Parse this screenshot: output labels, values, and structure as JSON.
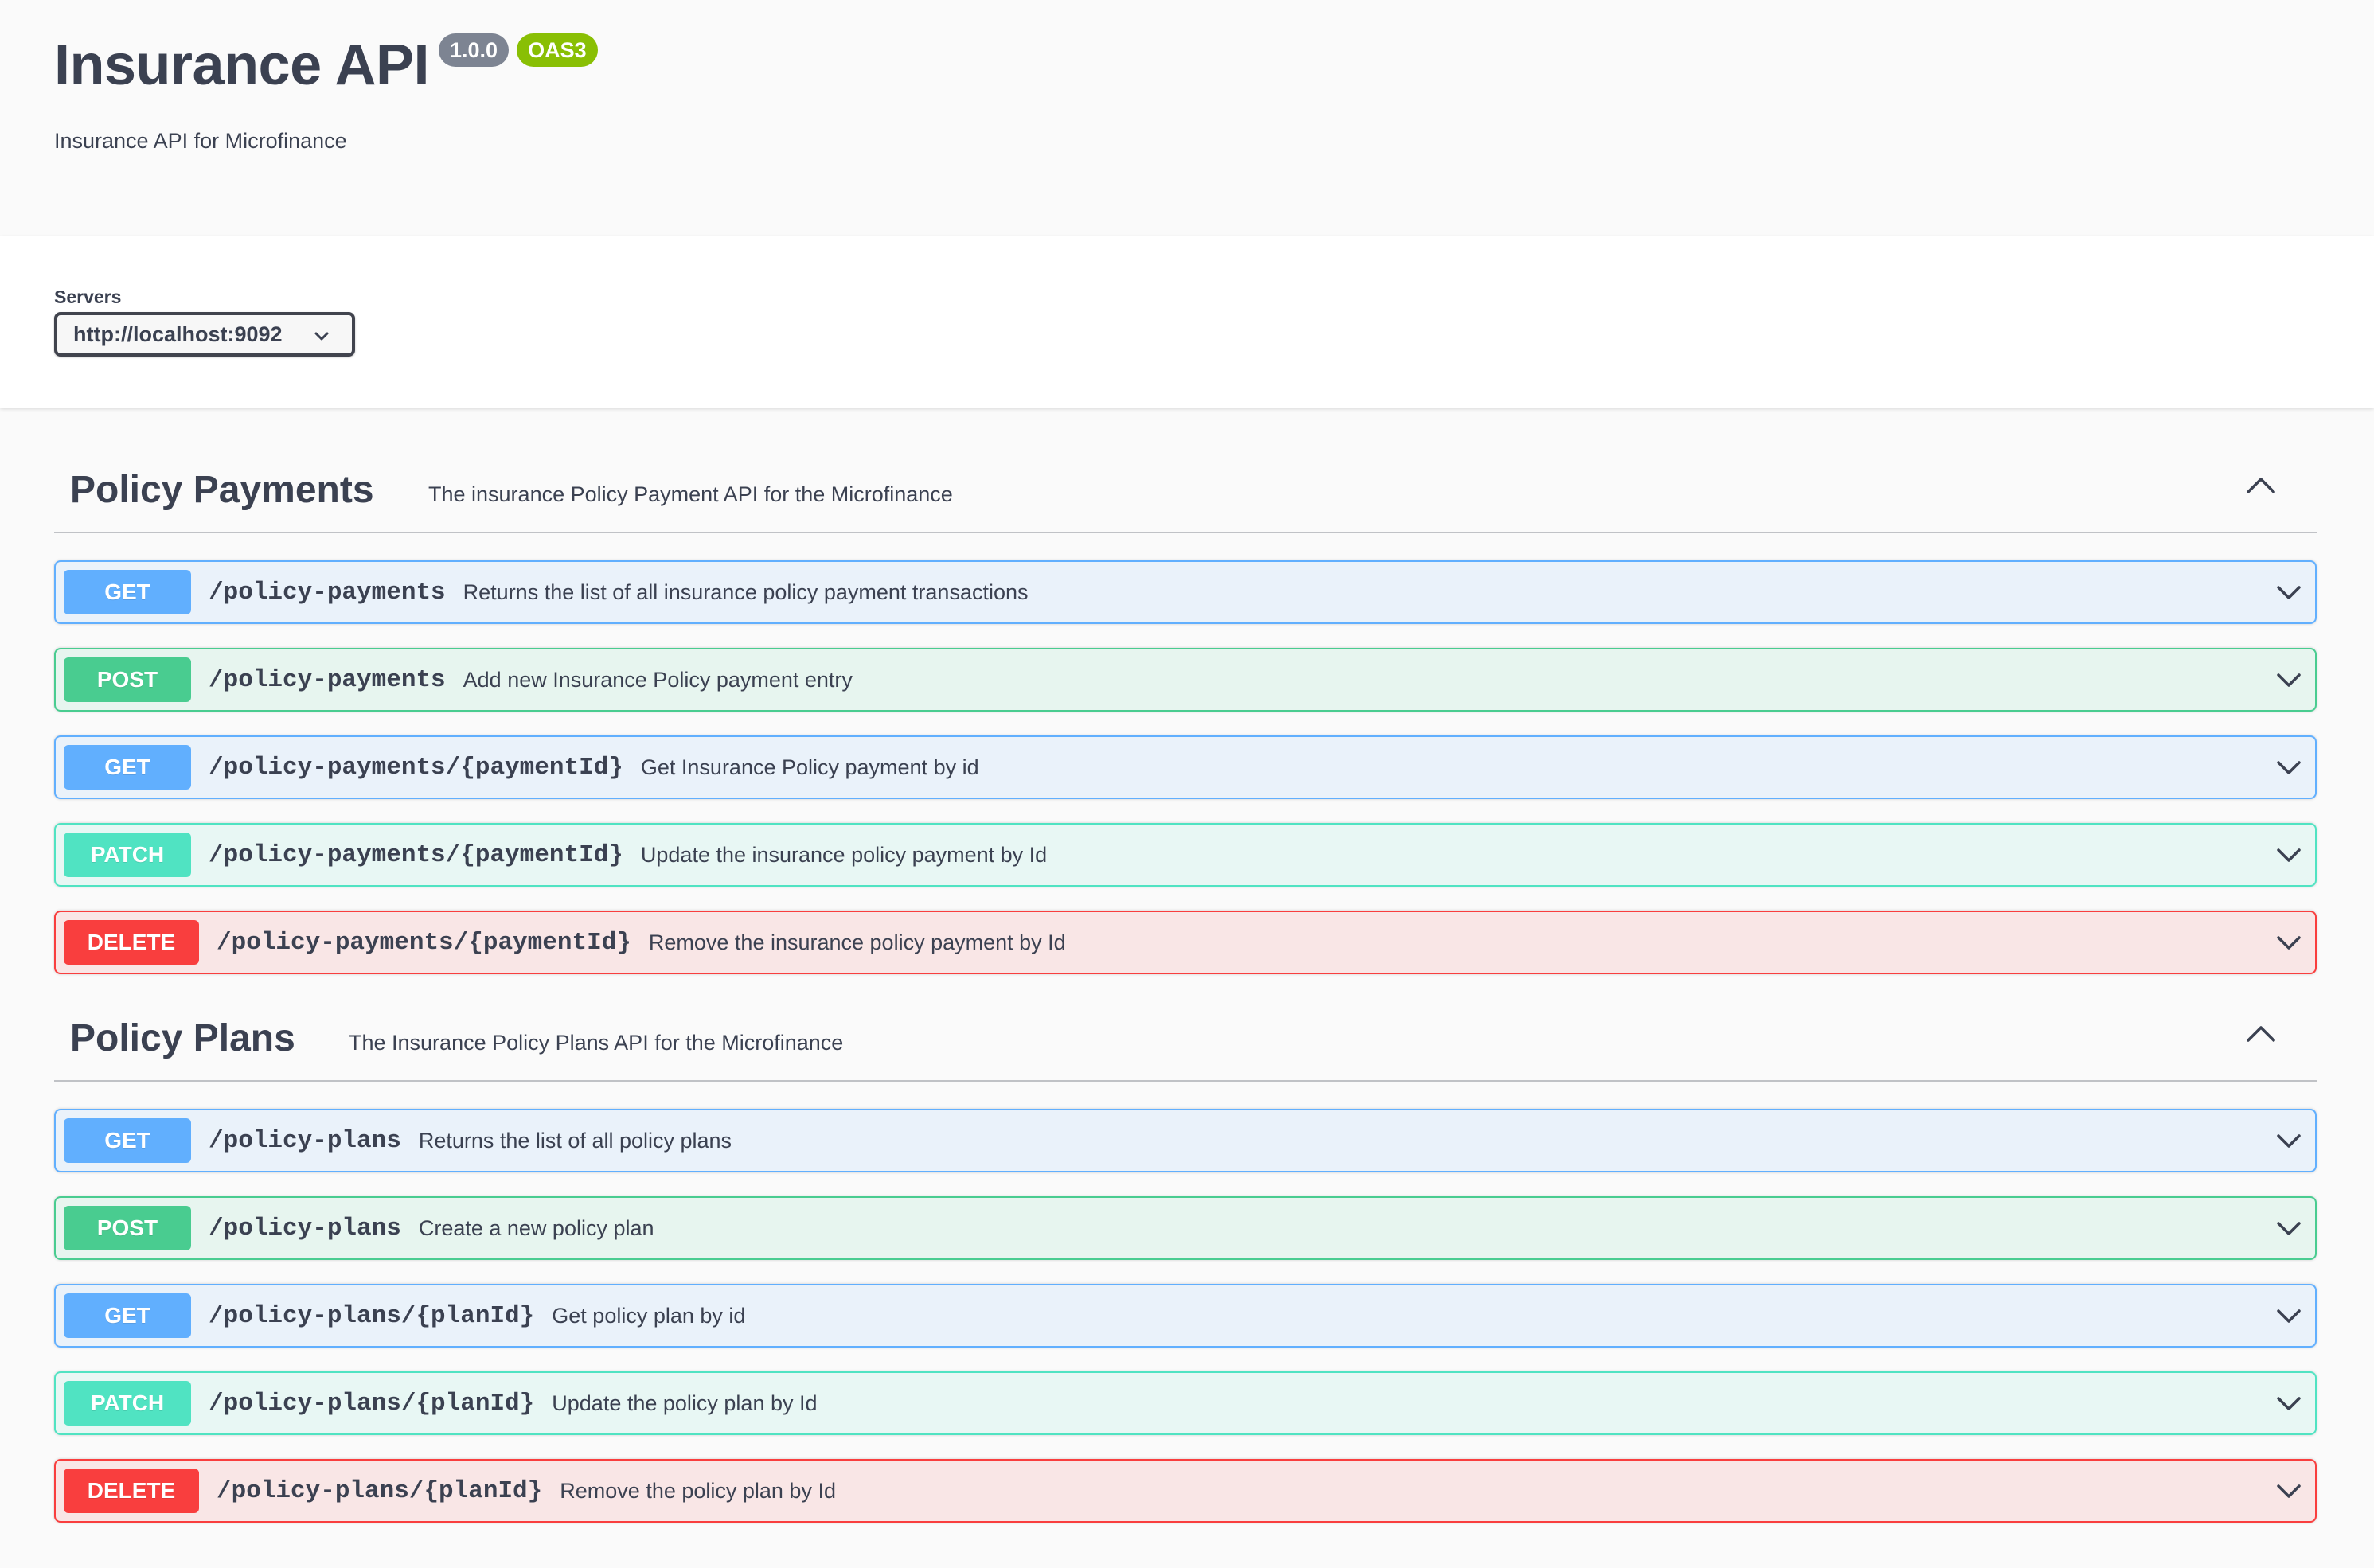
{
  "info": {
    "title": "Insurance API",
    "version": "1.0.0",
    "oas_badge": "OAS3",
    "description": "Insurance API for Microfinance"
  },
  "servers": {
    "label": "Servers",
    "selected": "http://localhost:9092"
  },
  "tags": [
    {
      "name": "Policy Payments",
      "description": "The insurance Policy Payment API for the Microfinance",
      "operations": [
        {
          "method": "GET",
          "path": "/policy-payments",
          "summary": "Returns the list of all insurance policy payment transactions"
        },
        {
          "method": "POST",
          "path": "/policy-payments",
          "summary": "Add new Insurance Policy payment entry"
        },
        {
          "method": "GET",
          "path": "/policy-payments/{paymentId}",
          "summary": "Get Insurance Policy payment by id"
        },
        {
          "method": "PATCH",
          "path": "/policy-payments/{paymentId}",
          "summary": "Update the insurance policy payment by Id"
        },
        {
          "method": "DELETE",
          "path": "/policy-payments/{paymentId}",
          "summary": "Remove the insurance policy payment by Id"
        }
      ]
    },
    {
      "name": "Policy Plans",
      "description": "The Insurance Policy Plans API for the Microfinance",
      "operations": [
        {
          "method": "GET",
          "path": "/policy-plans",
          "summary": "Returns the list of all policy plans"
        },
        {
          "method": "POST",
          "path": "/policy-plans",
          "summary": "Create a new policy plan"
        },
        {
          "method": "GET",
          "path": "/policy-plans/{planId}",
          "summary": "Get policy plan by id"
        },
        {
          "method": "PATCH",
          "path": "/policy-plans/{planId}",
          "summary": "Update the policy plan by Id"
        },
        {
          "method": "DELETE",
          "path": "/policy-plans/{planId}",
          "summary": "Remove the policy plan by Id"
        }
      ]
    }
  ],
  "colors": {
    "get": "#61affe",
    "post": "#49cc90",
    "patch": "#50e3c2",
    "delete": "#f93e3e",
    "version_badge": "#7d8492",
    "oas_badge": "#89bf04"
  },
  "icons": {
    "server_dropdown": "chevron-down-icon",
    "tag_toggle": "chevron-up-icon",
    "operation_expand": "chevron-down-icon"
  }
}
